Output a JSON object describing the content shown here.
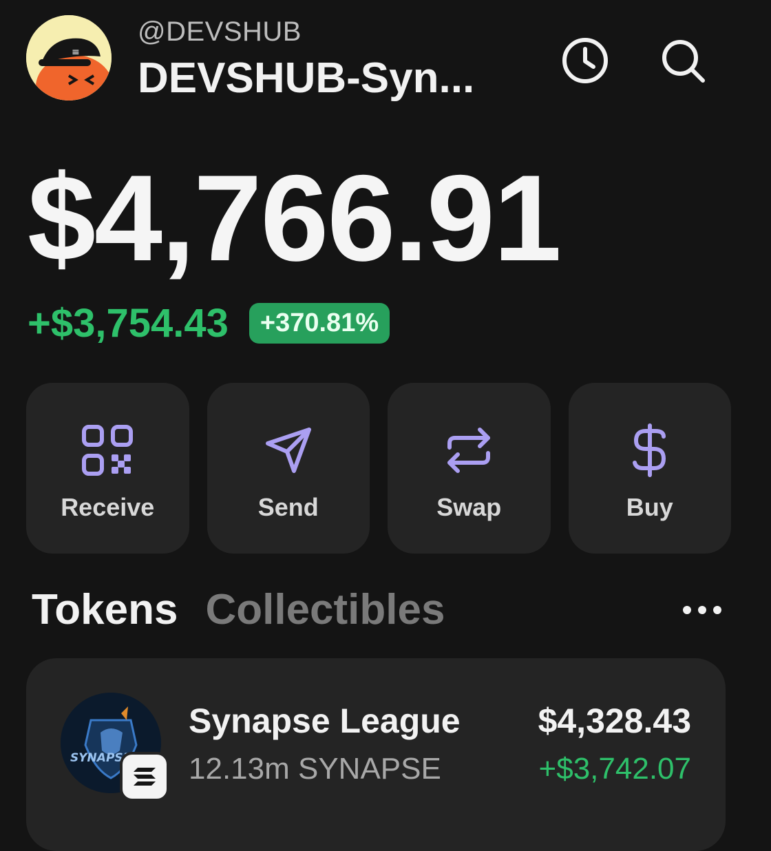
{
  "header": {
    "handle": "@DEVSHUB",
    "account_name": "DEVSHUB-Syn...",
    "icons": {
      "history": "clock-icon",
      "search": "search-icon"
    }
  },
  "balance": {
    "total": "$4,766.91",
    "change_amount": "+$3,754.43",
    "change_percent": "+370.81%"
  },
  "actions": [
    {
      "label": "Receive",
      "icon": "qr-code-icon"
    },
    {
      "label": "Send",
      "icon": "send-icon"
    },
    {
      "label": "Swap",
      "icon": "swap-icon"
    },
    {
      "label": "Buy",
      "icon": "dollar-icon"
    }
  ],
  "tabs": {
    "items": [
      {
        "label": "Tokens",
        "active": true
      },
      {
        "label": "Collectibles",
        "active": false
      }
    ],
    "more_icon": "more-horizontal-icon"
  },
  "tokens": [
    {
      "name": "Synapse League",
      "amount": "12.13m SYNAPSE",
      "value": "$4,328.43",
      "change": "+$3,742.07",
      "logo_text": "SYNAPSE LEAGUE",
      "chain_icon": "solana-icon"
    }
  ],
  "colors": {
    "background": "#141414",
    "card": "#242424",
    "accent_purple": "#ab9ff2",
    "positive_green": "#2ec06a"
  }
}
